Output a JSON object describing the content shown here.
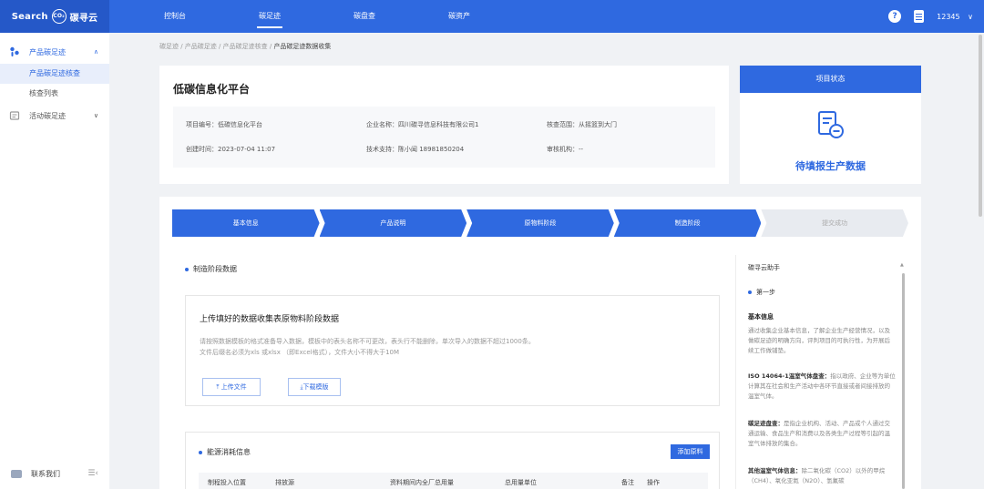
{
  "logo": {
    "prefix": "Search",
    "co2": "CO₂",
    "name": "碳寻云"
  },
  "nav": [
    {
      "label": "控制台",
      "active": false
    },
    {
      "label": "碳足迹",
      "active": true
    },
    {
      "label": "碳盘查",
      "active": false
    },
    {
      "label": "碳资产",
      "active": false
    }
  ],
  "user": {
    "name": "12345",
    "caret": "∨"
  },
  "sidebar": {
    "groups": [
      {
        "label": "产品碳足迹",
        "caret": "∧",
        "subs": [
          "产品碳足迹核查",
          "核查列表"
        ]
      },
      {
        "label": "活动碳足迹",
        "caret": "∨"
      }
    ],
    "contact": "联系我们",
    "collapse": "☰‹"
  },
  "breadcrumb": [
    "碳足迹",
    "产品碳足迹",
    "产品碳足迹核查",
    "产品碳足迹数据收集"
  ],
  "breadcrumb_sep": " / ",
  "project": {
    "title": "低碳信息化平台",
    "fields": [
      "项目编号：低碳信息化平台",
      "企业名称：四川碳寻信息科技有限公司1",
      "核查范围：从摇篮到大门",
      "创建时间：2023-07-04 11:07",
      "技术支持：陈小闻 18981850204",
      "审核机构：--"
    ]
  },
  "status": {
    "header": "项目状态",
    "text": "待填报生产数据"
  },
  "steps": [
    {
      "label": "基本信息",
      "done": true
    },
    {
      "label": "产品说明",
      "done": true
    },
    {
      "label": "原物料阶段",
      "done": true
    },
    {
      "label": "制造阶段",
      "done": true
    },
    {
      "label": "提交成功",
      "done": false
    }
  ],
  "manufacture": {
    "section_title": "制造阶段数据",
    "upload_title": "上传填好的数据收集表原物料阶段数据",
    "note1": "请按照数据模板的格式准备导入数据，模板中的表头名称不可更改，表头行不能删除，单次导入的数据不超过1000条。",
    "note2": "文件后缀名必须为xls 或xlsx （即Excel格式），文件大小不得大于10M",
    "upload_btn": "⤒ 上传文件",
    "download_btn": "⤓下载模版"
  },
  "energy": {
    "section_title": "能源消耗信息",
    "add_btn": "添加原料",
    "columns": [
      "制程投入位置",
      "排放源",
      "资料期间内全厂总用量",
      "总用量单位",
      "备注",
      "操作"
    ]
  },
  "assistant": {
    "title": "碳寻云助手",
    "step": "第一步",
    "heading": "基本信息",
    "intro": "通过收集企业基本信息，了解企业生产经营情况，以及做碳足迹的明确方向，评判项目的可执行性，为开展后续工作做铺垫。",
    "items": [
      {
        "term": "ISO 14064-1温室气体盘查：",
        "desc": "指以政府、企业等为单位计算其在社会和生产活动中各环节直接或者间接排放的温室气体。"
      },
      {
        "term": "碳足迹盘查：",
        "desc": "是指企业机构、活动、产品或个人通过交通运输、食品生产和消费以及各类生产过程等引起的温室气体排放的集合。"
      },
      {
        "term": "其他温室气体信息：",
        "desc": "除二氧化碳（CO2）以外的甲烷（CH4）、氧化亚氮（N2O）、氢氟碳"
      }
    ]
  }
}
